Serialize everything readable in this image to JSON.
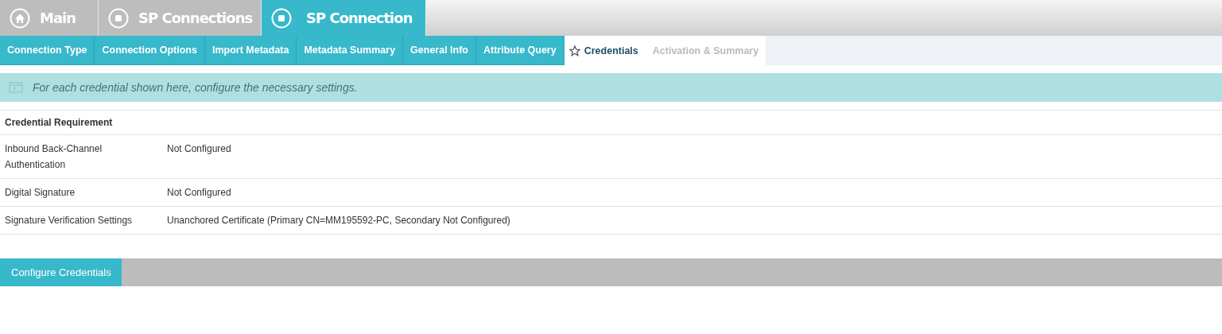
{
  "breadcrumbs": [
    {
      "label": "Main",
      "kind": "home",
      "selected": false
    },
    {
      "label": "SP Connections",
      "kind": "stop",
      "selected": false
    },
    {
      "label": "SP Connection",
      "kind": "stop",
      "selected": true
    }
  ],
  "steps": [
    {
      "label": "Connection Type",
      "kind": "done"
    },
    {
      "label": "Connection Options",
      "kind": "done"
    },
    {
      "label": "Import Metadata",
      "kind": "done"
    },
    {
      "label": "Metadata Summary",
      "kind": "done"
    },
    {
      "label": "General Info",
      "kind": "done"
    },
    {
      "label": "Attribute Query",
      "kind": "done"
    },
    {
      "label": "Credentials",
      "kind": "current"
    },
    {
      "label": "Activation & Summary",
      "kind": "pending"
    }
  ],
  "info_message": "For each credential shown here, configure the necessary settings.",
  "table": {
    "header": "Credential Requirement",
    "rows": [
      {
        "name": "Inbound Back-Channel Authentication",
        "value": "Not Configured"
      },
      {
        "name": "Digital Signature",
        "value": "Not Configured"
      },
      {
        "name": "Signature Verification Settings",
        "value": "Unanchored Certificate (Primary CN=MM195592-PC, Secondary Not Configured)"
      }
    ]
  },
  "button": "Configure Credentials"
}
